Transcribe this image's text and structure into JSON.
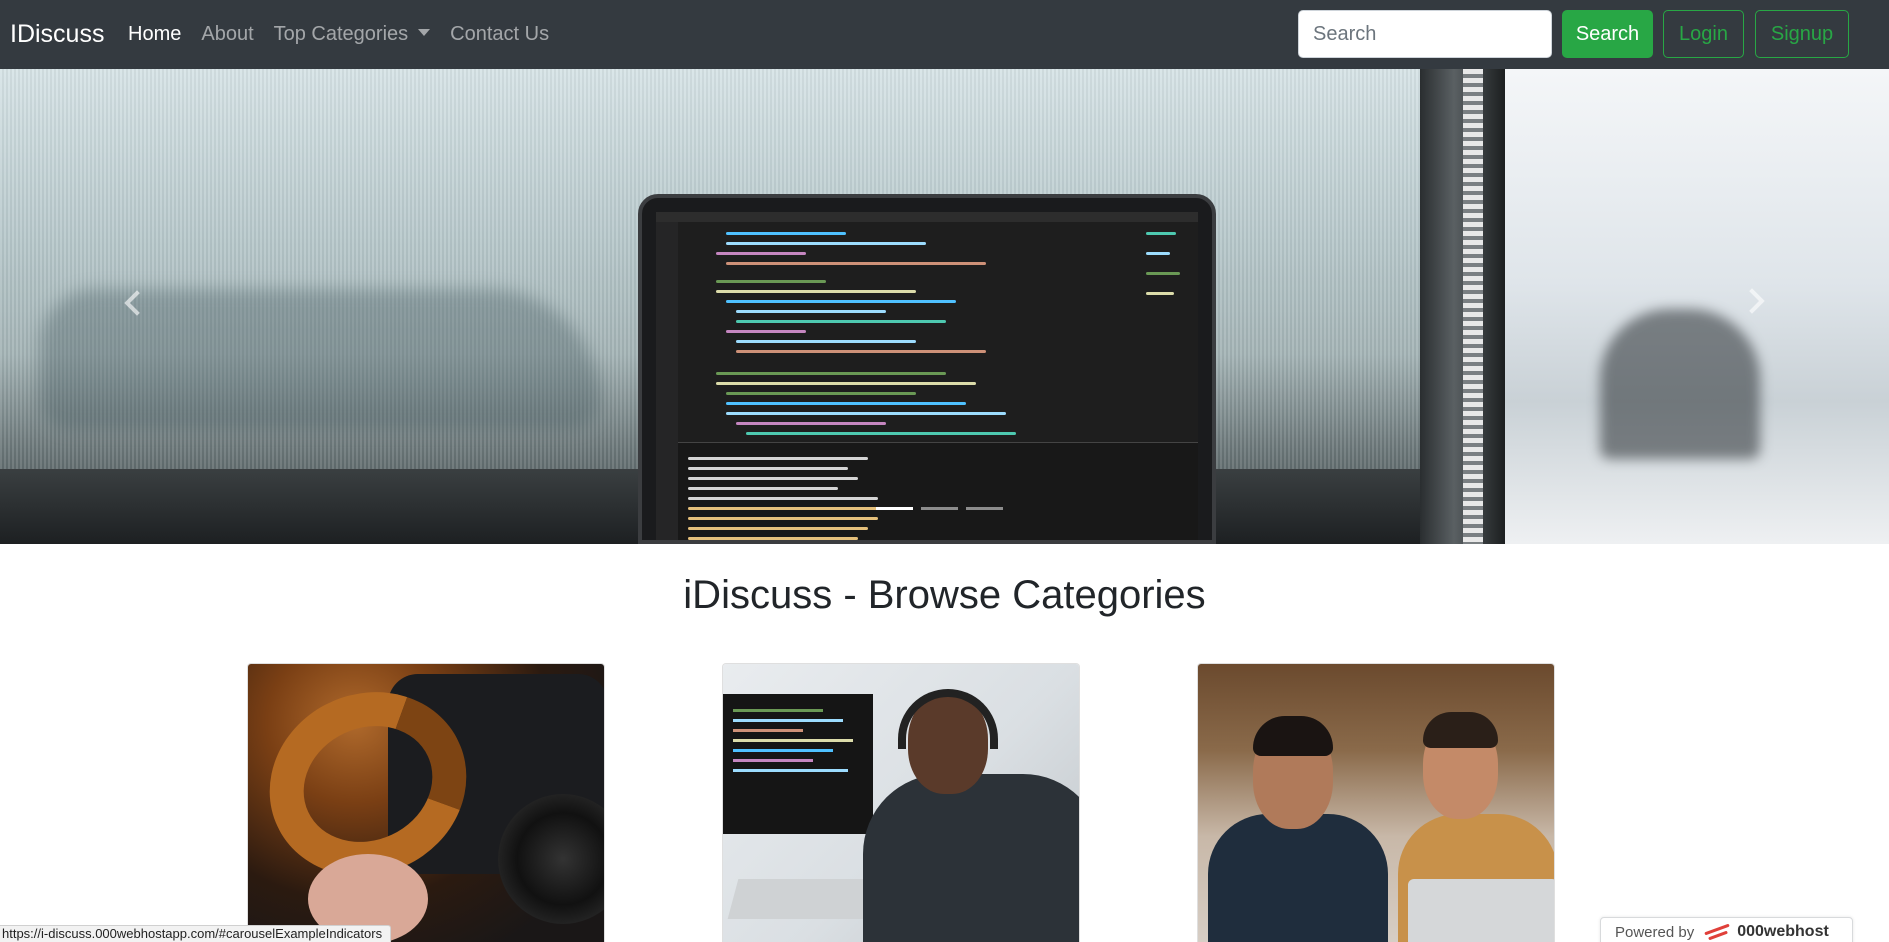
{
  "navbar": {
    "brand": "IDiscuss",
    "links": [
      {
        "label": "Home",
        "active": true
      },
      {
        "label": "About",
        "active": false
      },
      {
        "label": "Top Categories",
        "active": false,
        "dropdown": true
      },
      {
        "label": "Contact Us",
        "active": false
      }
    ],
    "search_placeholder": "Search",
    "search_button": "Search",
    "login_button": "Login",
    "signup_button": "Signup"
  },
  "carousel": {
    "indicator_count": 3,
    "active_indicator": 0,
    "prev_icon": "chevron-left-icon",
    "next_icon": "chevron-right-icon"
  },
  "main": {
    "heading": "iDiscuss - Browse Categories"
  },
  "statusbar": {
    "url": "https://i-discuss.000webhostapp.com/#carouselExampleIndicators"
  },
  "powered_badge": {
    "prefix": "Powered by",
    "brand": "000webhost"
  },
  "colors": {
    "navbar_bg": "#343a40",
    "accent_green": "#28a745",
    "heading_text": "#212529"
  }
}
